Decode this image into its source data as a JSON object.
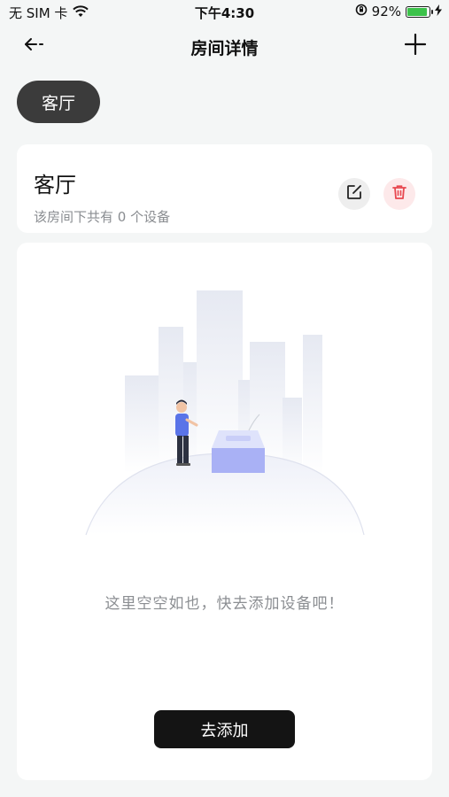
{
  "status_bar": {
    "carrier": "无 SIM 卡",
    "time": "下午4:30",
    "battery_percent": "92%",
    "battery_level": 0.92,
    "icons": [
      "wifi-icon",
      "orientation-lock-icon",
      "battery-icon",
      "charging-icon"
    ]
  },
  "nav": {
    "title": "房间详情",
    "back_icon": "back-arrow-icon",
    "add_icon": "plus-icon"
  },
  "room_chip": {
    "label": "客厅"
  },
  "room_card": {
    "name": "客厅",
    "device_count_text": "该房间下共有 0 个设备",
    "edit_icon": "edit-icon",
    "delete_icon": "trash-icon"
  },
  "empty_state": {
    "message": "这里空空如也，快去添加设备吧！",
    "button_label": "去添加"
  },
  "colors": {
    "background": "#f4f6f6",
    "chip": "#3b3b3b",
    "delete_bg": "#fde9ea",
    "delete_icon": "#e8474f",
    "primary_button": "#141414",
    "battery_green": "#3cc24a"
  }
}
